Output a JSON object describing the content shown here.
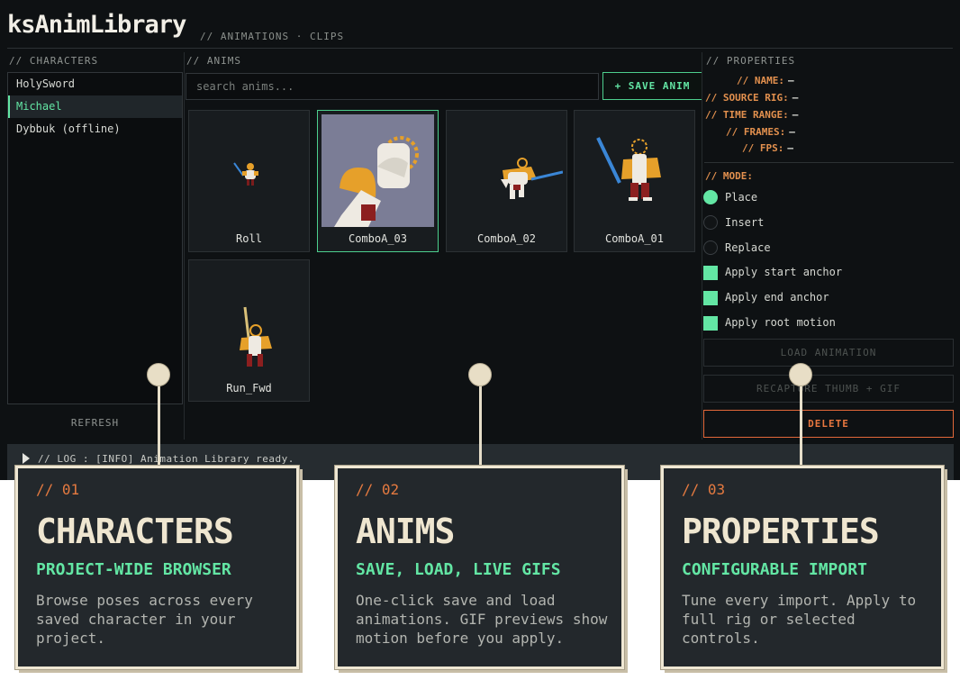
{
  "app": {
    "title": "ksAnimLibrary",
    "subtitle": "// ANIMATIONS · CLIPS"
  },
  "characters": {
    "header": "// CHARACTERS",
    "items": [
      {
        "label": "HolySword"
      },
      {
        "label": "Michael",
        "active": true
      },
      {
        "label": "Dybbuk  (offline)"
      }
    ],
    "refresh_label": "REFRESH"
  },
  "anims": {
    "header": "// ANIMS",
    "search_placeholder": "search anims...",
    "save_label": "+ SAVE ANIM",
    "clips": [
      {
        "label": "Roll"
      },
      {
        "label": "ComboA_03",
        "selected": true
      },
      {
        "label": "ComboA_02"
      },
      {
        "label": "ComboA_01"
      },
      {
        "label": "Run_Fwd"
      }
    ]
  },
  "properties": {
    "header": "// PROPERTIES",
    "fields": [
      {
        "label": "// NAME:",
        "value": "—"
      },
      {
        "label": "// SOURCE RIG:",
        "value": "—"
      },
      {
        "label": "// TIME RANGE:",
        "value": "—"
      },
      {
        "label": "// FRAMES:",
        "value": "—"
      },
      {
        "label": "// FPS:",
        "value": "—"
      }
    ],
    "mode_header": "// MODE:",
    "modes": [
      {
        "label": "Place",
        "selected": true
      },
      {
        "label": "Insert",
        "selected": false
      },
      {
        "label": "Replace",
        "selected": false
      }
    ],
    "options": [
      {
        "label": "Apply start anchor",
        "checked": true
      },
      {
        "label": "Apply end anchor",
        "checked": true
      },
      {
        "label": "Apply root motion",
        "checked": true
      }
    ],
    "load_label": "LOAD ANIMATION",
    "recapture_label": "RECAPTURE THUMB + GIF",
    "delete_label": "DELETE"
  },
  "log": {
    "text": "// LOG : [INFO] Animation Library ready."
  },
  "callouts": [
    {
      "num": "// 01",
      "title": "CHARACTERS",
      "subtitle": "PROJECT-WIDE BROWSER",
      "desc": "Browse poses across every saved character in your project."
    },
    {
      "num": "// 02",
      "title": "ANIMS",
      "subtitle": "SAVE, LOAD, LIVE GIFS",
      "desc": "One-click save and load animations. GIF previews show motion before you apply."
    },
    {
      "num": "// 03",
      "title": "PROPERTIES",
      "subtitle": "CONFIGURABLE IMPORT",
      "desc": "Tune every import. Apply to full rig or selected controls."
    }
  ],
  "colors": {
    "accent_green": "#63e6a4",
    "accent_orange": "#e2904e",
    "delete_red": "#e8773f",
    "background": "#0e1113"
  }
}
